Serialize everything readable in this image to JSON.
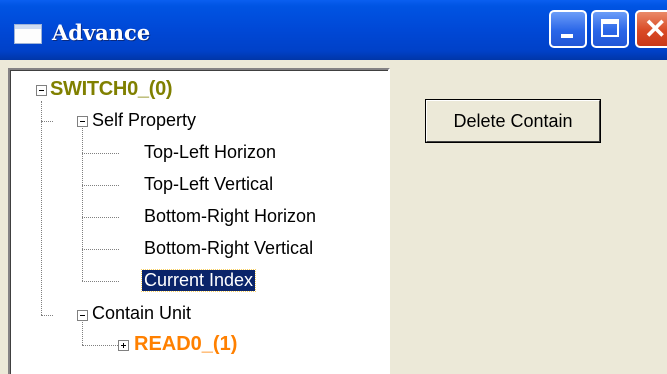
{
  "window": {
    "title": "Advance",
    "minimize_icon": "minimize-icon",
    "maximize_icon": "maximize-icon",
    "close_icon": "close-icon",
    "close_glyph": "✕"
  },
  "tree": {
    "root": {
      "label": "SWITCH0_(0)",
      "expanded": true,
      "color": "#808000"
    },
    "self_property": {
      "label": "Self Property",
      "expanded": true,
      "items": [
        "Top-Left Horizon",
        "Top-Left Vertical",
        "Bottom-Right Horizon",
        "Bottom-Right Vertical",
        "Current Index"
      ],
      "selected_index": 4
    },
    "contain_unit": {
      "label": "Contain Unit",
      "expanded": true,
      "child": {
        "label": "READ0_(1)",
        "expanded": false,
        "color": "#ff8000"
      }
    }
  },
  "buttons": {
    "delete_contain": "Delete Contain"
  }
}
